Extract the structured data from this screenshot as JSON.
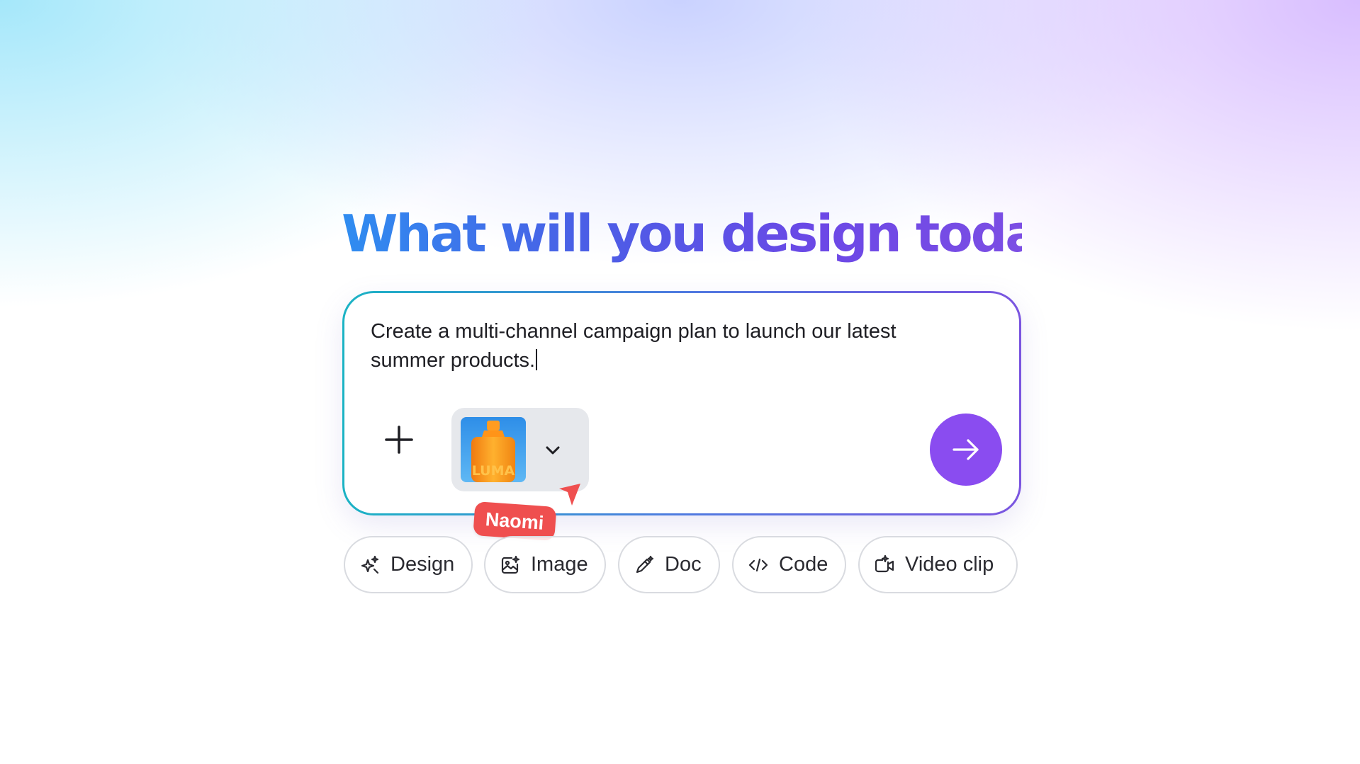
{
  "headline": "What will you design today?",
  "prompt": {
    "text": "Create a multi-channel campaign plan to launch our latest summer products."
  },
  "asset": {
    "thumbnail_label": "LUMA",
    "icon": "chevron-down-icon"
  },
  "collaborator": {
    "name": "Naomi",
    "color": "#ef4f4f"
  },
  "chips": [
    {
      "label": "Design",
      "icon": "sparkle-icon"
    },
    {
      "label": "Image",
      "icon": "image-plus-icon"
    },
    {
      "label": "Doc",
      "icon": "magic-pen-icon"
    },
    {
      "label": "Code",
      "icon": "code-icon"
    },
    {
      "label": "Video clip",
      "icon": "video-clip-icon"
    }
  ],
  "colors": {
    "accent": "#8a4cf0",
    "headline_start": "#2f8df0",
    "headline_end": "#7c4ee4"
  }
}
